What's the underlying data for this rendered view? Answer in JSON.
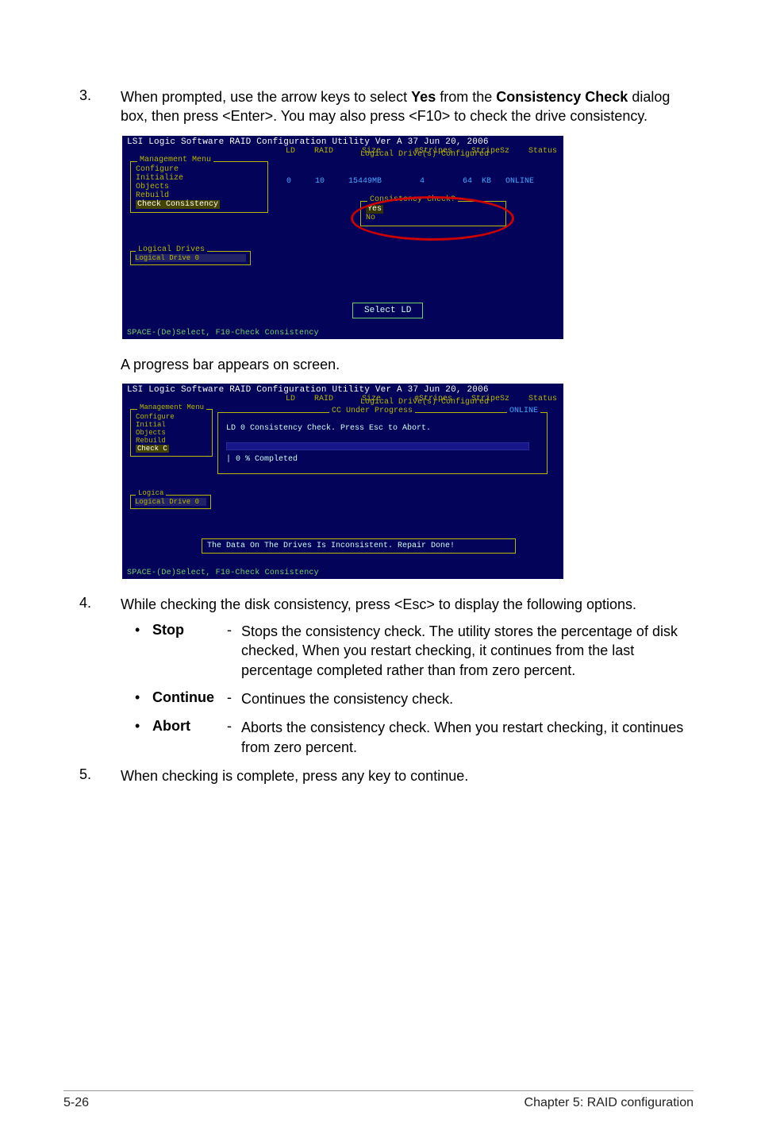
{
  "step3": {
    "num": "3.",
    "text_pre": "When prompted, use the arrow keys to select ",
    "bold1": "Yes",
    "text_mid1": " from the ",
    "bold2": "Consistency Check",
    "text_mid2": " dialog box, then press <Enter>. You may also press <F10> to check the drive consistency."
  },
  "shot1": {
    "title": "LSI Logic Software RAID Configuration Utility Ver A 37 Jun 20, 2006",
    "menu_title": "Management Menu",
    "menu_items": [
      "Configure",
      "Initialize",
      "Objects",
      "Rebuild",
      "Check Consistency"
    ],
    "ld_section_title": "Logical Drive(s) Configured",
    "ld_header": " LD    RAID      Size       #Stripes    StripeSz    Status",
    "ld_row": "  0     10     15449MB        4        64  KB   ONLINE",
    "modal_title": "Consistency Check?",
    "modal_yes": "Yes",
    "modal_no": "No",
    "drives_title": "Logical Drives",
    "drives_item": "Logical Drive 0",
    "select_btn": "Select LD",
    "footer": "SPACE-(De)Select,  F10-Check Consistency"
  },
  "caption_progress": "A progress bar appears on screen.",
  "shot2": {
    "title": "LSI Logic Software RAID Configuration Utility Ver A 37 Jun 20, 2006",
    "menu_title": "Management Menu",
    "menu_items": [
      "Configure",
      "Initial",
      "Objects",
      "Rebuild",
      "Check C"
    ],
    "ld_section_title": "Logical Drive(s) Configured",
    "ld_header": " LD    RAID      Size       #Stripes    StripeSz    Status",
    "ld_status_trail": "ONLINE",
    "cc_title": "CC Under Progress",
    "cc_msg": "LD 0 Consistency Check. Press Esc to Abort.",
    "cc_pct": "| 0  % Completed",
    "drives_title": "Logica",
    "drives_item": "Logical Drive 0",
    "repair_msg": "The Data On The Drives Is Inconsistent. Repair Done!",
    "footer": "SPACE-(De)Select,  F10-Check Consistency"
  },
  "step4": {
    "num": "4.",
    "text": "While checking the disk consistency, press <Esc> to display the following options."
  },
  "options": [
    {
      "name": "Stop",
      "desc": "Stops the consistency check. The utility stores the percentage of disk checked, When you restart checking, it continues from the last percentage completed rather than from zero percent."
    },
    {
      "name": "Continue",
      "desc": "Continues the consistency check."
    },
    {
      "name": "Abort",
      "desc": "Aborts the consistency check. When you restart checking, it continues from zero percent."
    }
  ],
  "step5": {
    "num": "5.",
    "text": "When checking is complete, press any key to continue."
  },
  "footer": {
    "left": "5-26",
    "right": "Chapter 5: RAID configuration"
  }
}
